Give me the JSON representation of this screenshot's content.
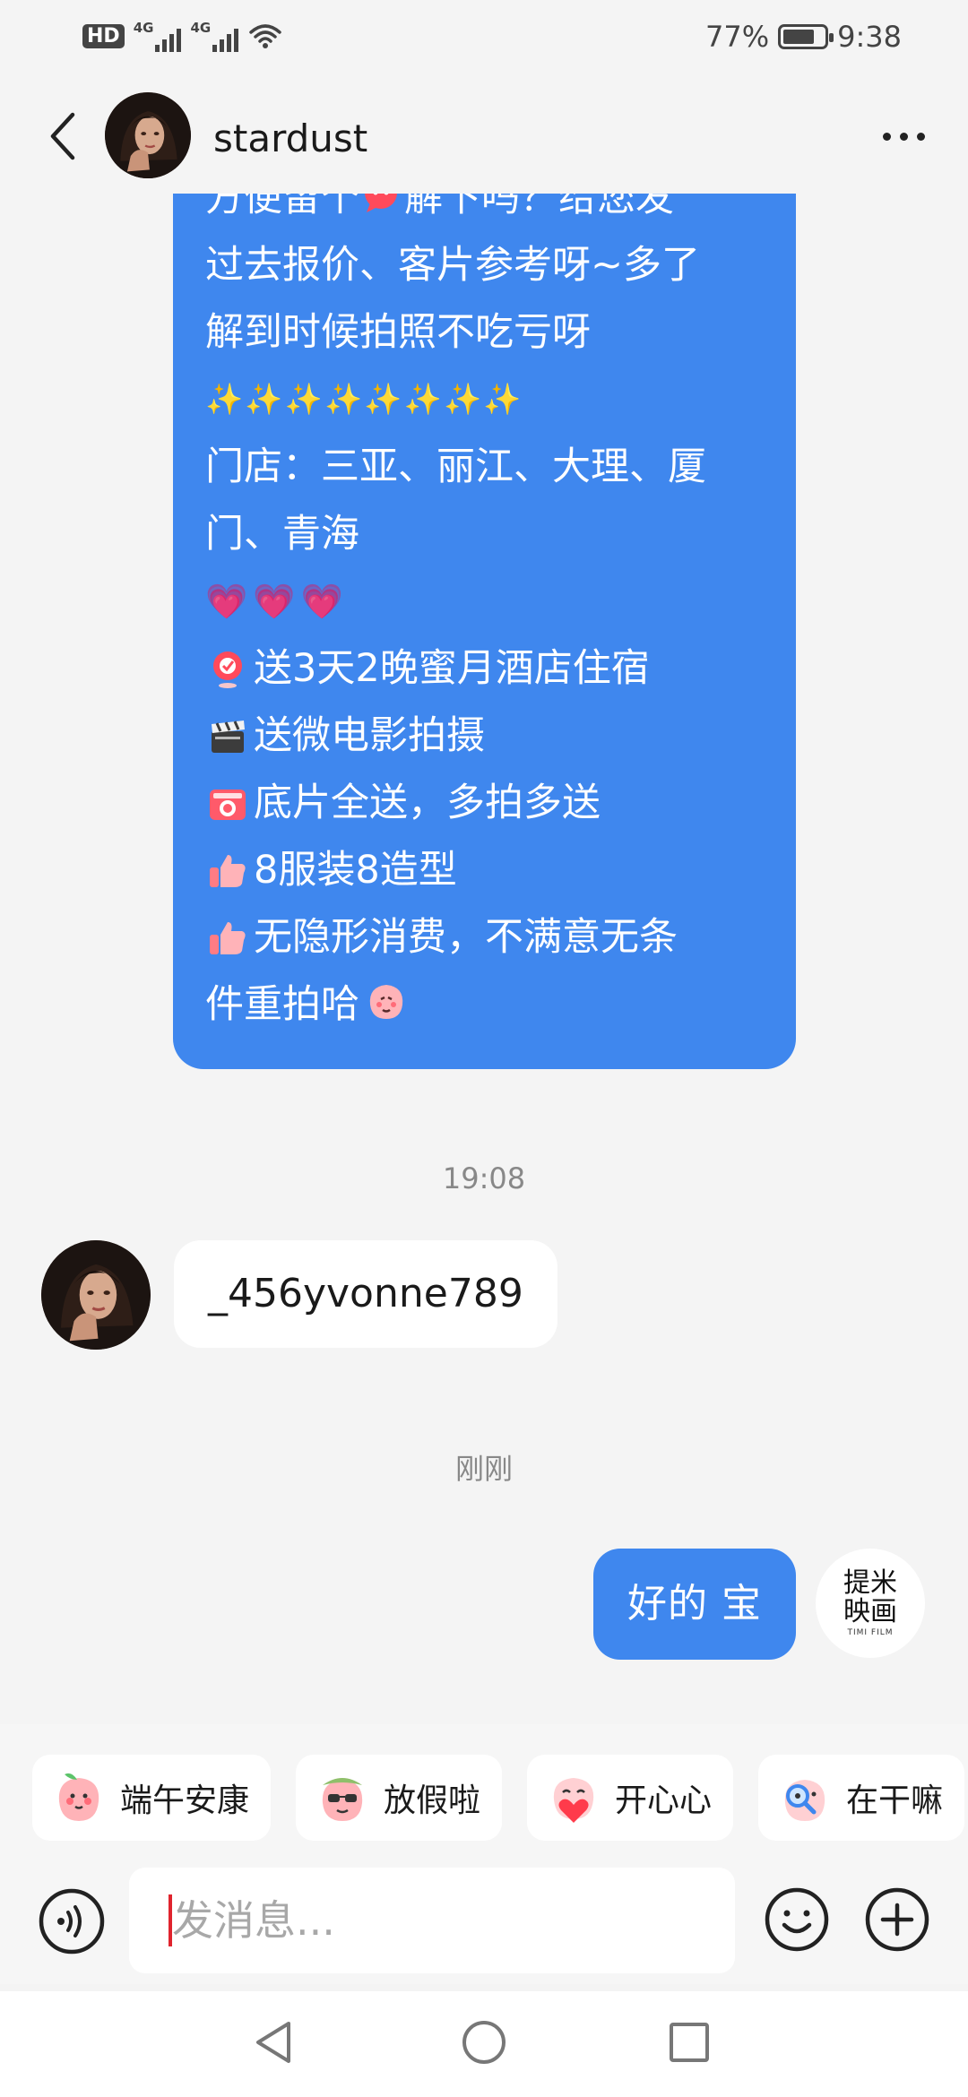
{
  "status_bar": {
    "hd_label": "HD",
    "signal_1_label": "4G",
    "signal_2_label": "4G",
    "battery_percent": "77%",
    "battery_level": 0.77,
    "time": "9:38"
  },
  "header": {
    "contact_name": "stardust",
    "avatar_icon": "avatar-photo-icon",
    "back_icon": "chevron-left-icon",
    "more_icon": "more-dots-icon"
  },
  "messages": {
    "promo": {
      "line1_pre": "方便留个",
      "line1_post": "解下吗？给您发",
      "line2": "过去报价、客片参考呀~多了",
      "line3": "解到时候拍照不吃亏呀",
      "sparkles": "✨✨✨✨✨✨✨✨",
      "line5": "门店：三亚、丽江、大理、厦",
      "line6": "门、青海",
      "hearts": "💗💗💗",
      "item1": "送3天2晚蜜月酒店住宿",
      "item2": "送微电影拍摄",
      "item3": "底片全送，多拍多送",
      "item4": "8服装8造型",
      "item5a": "无隐形消费，不满意无条",
      "item5b": "件重拍哈"
    },
    "timestamp_1": "19:08",
    "incoming_text": "_456yvonne789",
    "timestamp_2": "刚刚",
    "outgoing_text": "好的 宝",
    "my_avatar_logo": "提米映画",
    "my_avatar_sub": "TIMI FILM"
  },
  "quick_replies": [
    {
      "label": "端午安康",
      "icon": "peach-sticker-icon"
    },
    {
      "label": "放假啦",
      "icon": "peach-sunglasses-sticker-icon"
    },
    {
      "label": "开心心",
      "icon": "peach-heart-sticker-icon"
    },
    {
      "label": "在干嘛",
      "icon": "peach-magnifier-sticker-icon"
    }
  ],
  "input": {
    "placeholder": "发消息..."
  },
  "colors": {
    "accent_blue": "#3f87ee",
    "background": "#f4f4f4"
  }
}
